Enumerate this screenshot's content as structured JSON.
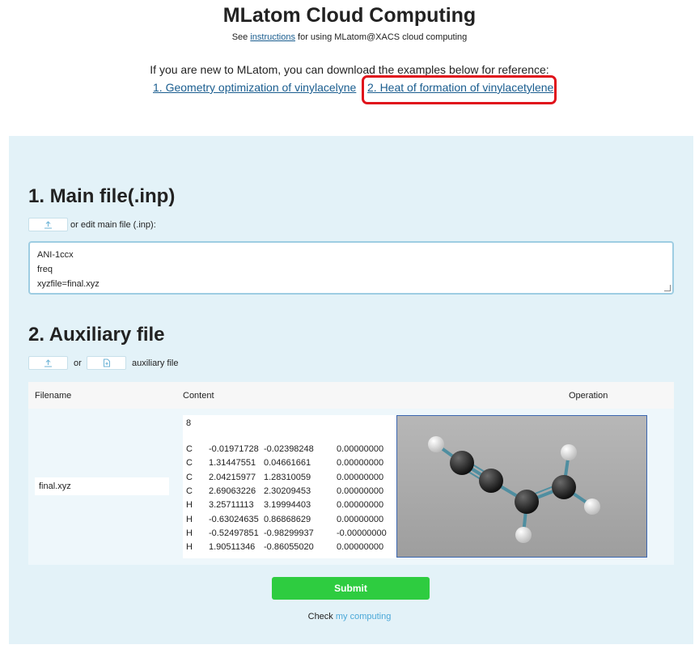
{
  "header": {
    "title": "MLatom Cloud Computing",
    "subtitle_prefix": "See ",
    "subtitle_link": "instructions",
    "subtitle_suffix": " for using MLatom@XACS cloud computing"
  },
  "intro": {
    "text": "If you are new to MLatom, you can download the examples below for reference:",
    "example1": "1. Geometry optimization of vinylacelyne",
    "example2": "2. Heat of formation of vinylacetylene"
  },
  "main_file": {
    "title": "1. Main file(.inp)",
    "hint": "or edit main file (.inp):",
    "lines": [
      "ANI-1ccx",
      "freq",
      "xyzfile=final.xyz"
    ]
  },
  "aux_file": {
    "title": "2. Auxiliary file",
    "or_text": "or",
    "hint": "auxiliary file",
    "table": {
      "headers": [
        "Filename",
        "Content",
        "Operation"
      ],
      "filename": "final.xyz",
      "atom_count": "8",
      "atoms": [
        [
          "C",
          "-0.01971728",
          "-0.02398248",
          "0.00000000"
        ],
        [
          "C",
          "1.31447551",
          "0.04661661",
          "0.00000000"
        ],
        [
          "C",
          "2.04215977",
          "1.28310059",
          "0.00000000"
        ],
        [
          "C",
          "2.69063226",
          "2.30209453",
          "0.00000000"
        ],
        [
          "H",
          "3.25711113",
          "3.19994403",
          "0.00000000"
        ],
        [
          "H",
          "-0.63024635",
          "0.86868629",
          "0.00000000"
        ],
        [
          "H",
          "-0.52497851",
          "-0.98299937",
          "-0.00000000"
        ],
        [
          "H",
          "1.90511346",
          "-0.86055020",
          "0.00000000"
        ]
      ]
    }
  },
  "actions": {
    "submit_label": "Submit",
    "check_prefix": "Check ",
    "check_link": "my computing"
  },
  "colors": {
    "accent_link": "#1a5d8f",
    "highlight": "#e0121b",
    "submit": "#2ecc40",
    "panel": "#e3f2f8"
  }
}
